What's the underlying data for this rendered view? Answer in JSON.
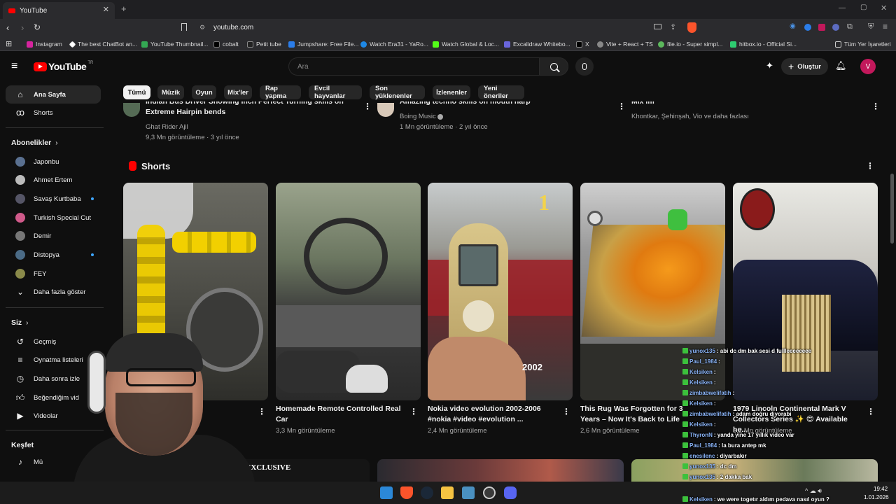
{
  "browser": {
    "tab_title": "YouTube",
    "new_tab": "+",
    "url": "youtube.com",
    "bookmarks": [
      {
        "label": "Instagram",
        "color": "#d6249f"
      },
      {
        "label": "The best ChatBot an...",
        "color": "#ffffff"
      },
      {
        "label": "YouTube Thumbnail...",
        "color": "#34a853"
      },
      {
        "label": "cobalt",
        "color": "#000000"
      },
      {
        "label": "Petit tube",
        "color": "#222222"
      },
      {
        "label": "Jumpshare: Free File...",
        "color": "#2b7de9"
      },
      {
        "label": "Watch Era31 - YaRo...",
        "color": "#1e88e5"
      },
      {
        "label": "Watch Global & Loc...",
        "color": "#53fc18"
      },
      {
        "label": "Excalidraw Whitebo...",
        "color": "#6965db"
      },
      {
        "label": "X",
        "color": "#000000"
      },
      {
        "label": "Vite + React + TS",
        "color": "#888888"
      },
      {
        "label": "file.io - Super simpl...",
        "color": "#5cb85c"
      },
      {
        "label": "hitbox.io - Official Si...",
        "color": "#2ecc71"
      }
    ],
    "all_bookmarks": "Tüm Yer İşaretleri"
  },
  "youtube": {
    "logo_text": "YouTube",
    "logo_region": "TR",
    "search_placeholder": "Ara",
    "create_label": "Oluştur",
    "avatar_letter": "V",
    "chips": [
      "Tümü",
      "Müzik",
      "Oyun",
      "Mix'ler",
      "Rap yapma",
      "Evcil hayvanlar",
      "Son yüklenenler",
      "İzlenenler",
      "Yeni öneriler"
    ],
    "sidebar": {
      "home": "Ana Sayfa",
      "shorts": "Shorts",
      "subscriptions_header": "Abonelikler",
      "subscriptions": [
        {
          "name": "Japonbu",
          "dot": false
        },
        {
          "name": "Ahmet Ertem",
          "dot": false
        },
        {
          "name": "Savaş Kurtbaba",
          "dot": true
        },
        {
          "name": "Turkish Special Cut",
          "dot": false
        },
        {
          "name": "Demir",
          "dot": false
        },
        {
          "name": "Distopya",
          "dot": true
        },
        {
          "name": "FEY",
          "dot": false
        }
      ],
      "show_more": "Daha fazla göster",
      "you_header": "Siz",
      "you_items": [
        "Geçmiş",
        "Oynatma listeleri",
        "Daha sonra izle",
        "Beğendiğim vid",
        "Videolar"
      ],
      "explore_header": "Keşfet",
      "explore_items": [
        "Mü"
      ]
    },
    "top_row": [
      {
        "title_line1": "Indian Bus Driver Showing Inch Perfect Turning skills on",
        "title_line2": "Extreme Hairpin bends",
        "channel": "Ghat Rider Ajil",
        "meta": "9,3 Mn görüntüleme · 3 yıl önce"
      },
      {
        "title_line1": "Amazing techno skills on mouth harp",
        "channel": "Boing Music",
        "meta": "1 Mn görüntüleme · 2 yıl önce"
      },
      {
        "title_line1": "Mix Im",
        "channel": "Khontkar, Şehinşah, Vio ve daha fazlası"
      }
    ],
    "shorts_header": "Shorts",
    "shorts": [
      {
        "title": "",
        "views": ""
      },
      {
        "title": "Homemade Remote Controlled Real Car",
        "views": "3,3 Mn görüntüleme"
      },
      {
        "title": "Nokia video  evolution 2002-2006 #nokia #video #evolution ...",
        "views": "2,4 Mn görüntüleme"
      },
      {
        "title": "This Rug Was Forgotten for 3 Years – Now It's Back to Life",
        "views": "2,6 Mn görüntüleme"
      },
      {
        "title": "1979 Lincoln Continental Mark V Collectors Series ✨ 😍 Available he...",
        "views": "3,2 Mn görüntüleme"
      }
    ],
    "nokia_overlay_number": "1",
    "nokia_overlay_year": "2002",
    "bottom_label": "EXCLUSIVE"
  },
  "chat": [
    {
      "user": "yunox135",
      "msg": ": abi dc dm bak sesi d fullleeeeeeee"
    },
    {
      "user": "Paul_1984",
      "msg": ":"
    },
    {
      "user": "Kelsiken",
      "msg": ":"
    },
    {
      "user": "Kelsiken",
      "msg": ":"
    },
    {
      "user": "zimbabwelifatih",
      "msg": ":"
    },
    {
      "user": "Kelsiken",
      "msg": ":"
    },
    {
      "user": "zimbabwelifatih",
      "msg": ": adam doğru diyorabi"
    },
    {
      "user": "Kelsiken",
      "msg": ":"
    },
    {
      "user": "ThyronN",
      "msg": ": yanda yine 17 yıllık video var"
    },
    {
      "user": "Paul_1984",
      "msg": ": la bura antep mk"
    },
    {
      "user": "enesilenc",
      "msg": ": diyarbakır"
    },
    {
      "user": "yunox135",
      "msg": ": dc dm"
    },
    {
      "user": "yunox135",
      "msg": ": 2 dakka bak"
    },
    {
      "user": "Kelsiken",
      "msg": ": we were togetır aldım pedava nasıl oyun ?"
    }
  ],
  "taskbar": {
    "time": "19:42",
    "date": "1.01.2026"
  }
}
